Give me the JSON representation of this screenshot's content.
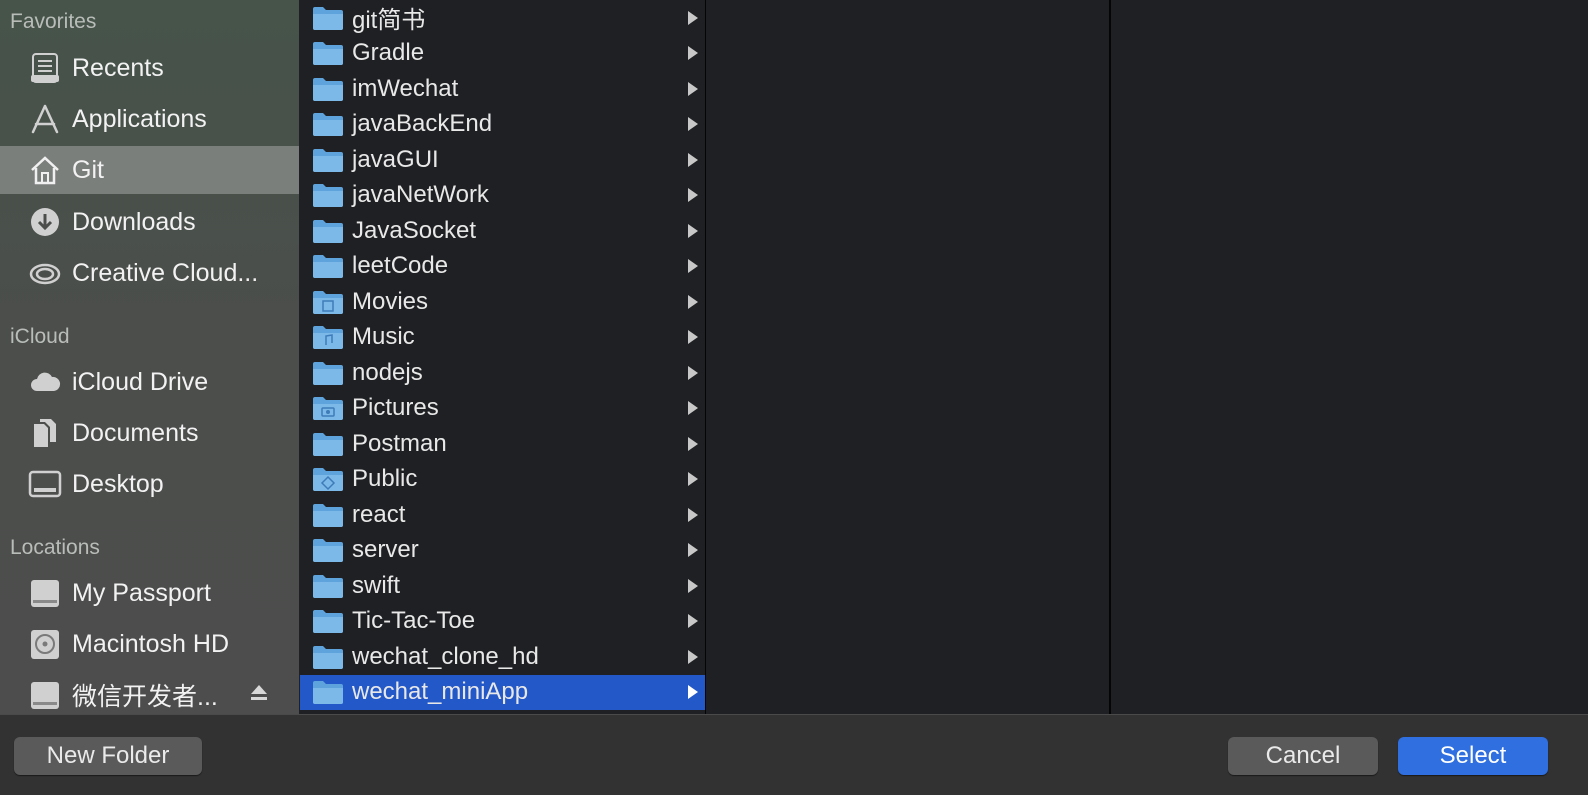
{
  "sidebar": {
    "favorites_heading": "Favorites",
    "icloud_heading": "iCloud",
    "locations_heading": "Locations",
    "favorites": [
      {
        "label": "Recents",
        "icon": "recents-icon"
      },
      {
        "label": "Applications",
        "icon": "applications-icon"
      },
      {
        "label": "Git",
        "icon": "home-icon",
        "selected": true
      },
      {
        "label": "Downloads",
        "icon": "downloads-icon"
      },
      {
        "label": "Creative Cloud...",
        "icon": "creative-cloud-icon"
      }
    ],
    "icloud": [
      {
        "label": "iCloud Drive",
        "icon": "cloud-icon"
      },
      {
        "label": "Documents",
        "icon": "documents-icon"
      },
      {
        "label": "Desktop",
        "icon": "desktop-icon"
      }
    ],
    "locations": [
      {
        "label": "My Passport",
        "icon": "external-drive-icon"
      },
      {
        "label": "Macintosh HD",
        "icon": "hard-drive-icon"
      },
      {
        "label": "微信开发者...",
        "icon": "external-drive-icon",
        "ejectable": true
      }
    ]
  },
  "browser": {
    "folders": [
      "git简书",
      "Gradle",
      "imWechat",
      "javaBackEnd",
      "javaGUI",
      "javaNetWork",
      "JavaSocket",
      "leetCode",
      "Movies",
      "Music",
      "nodejs",
      "Pictures",
      "Postman",
      "Public",
      "react",
      "server",
      "swift",
      "Tic-Tac-Toe",
      "wechat_clone_hd",
      "wechat_miniApp"
    ],
    "selected": "wechat_miniApp"
  },
  "buttons": {
    "new_folder": "New Folder",
    "cancel": "Cancel",
    "select": "Select"
  },
  "colors": {
    "selection": "#2358c8",
    "primary_button": "#2f6fe0",
    "folder": "#5ea3dc"
  }
}
